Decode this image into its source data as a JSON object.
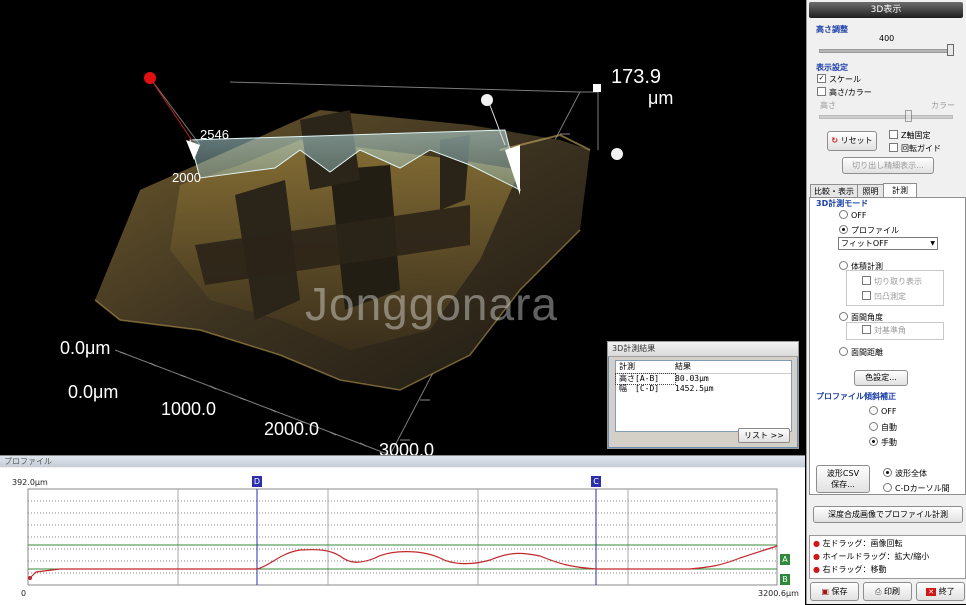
{
  "viewport": {
    "max_height_value": "173.9",
    "max_height_unit": "μm",
    "left_label_a": "2546",
    "left_label_b": "2000",
    "z_axis_origin": "0.0μm",
    "y_axis_origin": "0.0μm",
    "x_tick_1000": "1000.0",
    "x_tick_2000": "2000.0",
    "x_tick_3000": "3000.0",
    "watermark": "Jonggonara"
  },
  "result_window": {
    "title": "3D計測結果",
    "headers": [
      "計測",
      "結果"
    ],
    "rows": [
      {
        "name": "高さ[A-B]",
        "value": "80.03μm"
      },
      {
        "name": "幅　[C-D]",
        "value": "1452.5μm"
      }
    ],
    "list_button": "リスト >>"
  },
  "profile": {
    "title": "プロファイル",
    "y_max": "392.0μm",
    "x_min": "0",
    "x_max": "3200.6μm",
    "marker_d": "D",
    "marker_c": "C",
    "marker_a": "A",
    "marker_b": "B",
    "line_color": "#c0282c",
    "marker_color": "#2a2fb0"
  },
  "side": {
    "title": "3D表示",
    "height_adjust": {
      "label": "高さ調整",
      "value": "400",
      "level": 1.0
    },
    "display": {
      "label": "表示設定",
      "scale": "スケール",
      "scale_checked": true,
      "height_color": "高さ/カラー",
      "height_color_checked": false,
      "left_label": "高さ",
      "right_label": "カラー"
    },
    "reset_button": "リセット",
    "z_fix": "Z軸固定",
    "rotate_guide": "回転ガイド",
    "cutout_button": "切り出し精細表示...",
    "tabs": [
      "比較・表示",
      "照明",
      "計測"
    ],
    "active_tab": "計測",
    "mode": {
      "label": "3D計測モード",
      "off": "OFF",
      "profile": "プロファイル",
      "fit_select": "フィットOFF",
      "volume": "体積計測",
      "cutout_display": "切り取り表示",
      "concave_convex": "凹凸測定",
      "angle": "面間角度",
      "opposite_angle": "対基準角",
      "distance": "面間距離",
      "selected": "profile"
    },
    "color_settings": "色設定...",
    "tilt": {
      "label": "プロファイル傾斜補正",
      "off": "OFF",
      "auto": "自動",
      "manual": "手動",
      "selected": "manual"
    },
    "csv_button_line1": "波形CSV",
    "csv_button_line2": "保存...",
    "wave_all": "波形全体",
    "cursor_between": "C-Dカーソル間",
    "wave_selected": "all",
    "depth_button": "深度合成画像でプロファイル計測",
    "help": [
      "左ドラッグ：画像回転",
      "ホイールドラッグ：拡大/縮小",
      "右ドラッグ：移動"
    ],
    "save": "保存",
    "print": "印刷",
    "exit": "終了"
  }
}
